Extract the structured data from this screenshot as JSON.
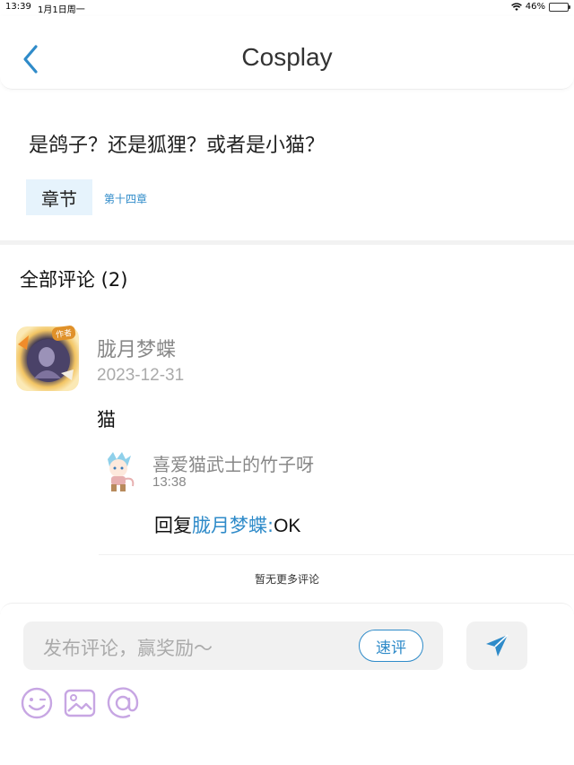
{
  "status_bar": {
    "time": "13:39",
    "date": "1月1日周一",
    "battery": "46%",
    "battery_level": 0.46
  },
  "nav": {
    "title": "Cosplay",
    "back_icon": "chevron-left-icon"
  },
  "post": {
    "title": "是鸽子？还是狐狸？或者是小猫？",
    "chapter_tag": "章节",
    "chapter_name": "第十四章"
  },
  "comments": {
    "heading": "全部评论 (2)",
    "items": [
      {
        "user": "胧月梦蝶",
        "badge": "作者",
        "date": "2023-12-31",
        "text": "猫",
        "replies": [
          {
            "user": "喜爱猫武士的竹子呀",
            "time": "13:38",
            "prefix": "回复",
            "mention": "胧月梦蝶:",
            "text": "OK"
          }
        ]
      }
    ],
    "no_more": "暂无更多评论"
  },
  "composer": {
    "placeholder": "发布评论，赢奖励～",
    "quick_label": "速评",
    "send_icon": "send-icon",
    "tools": [
      "emoji-icon",
      "image-icon",
      "at-icon"
    ]
  },
  "colors": {
    "accent": "#2f8bc9",
    "tool_purple": "#c7a6e3"
  }
}
